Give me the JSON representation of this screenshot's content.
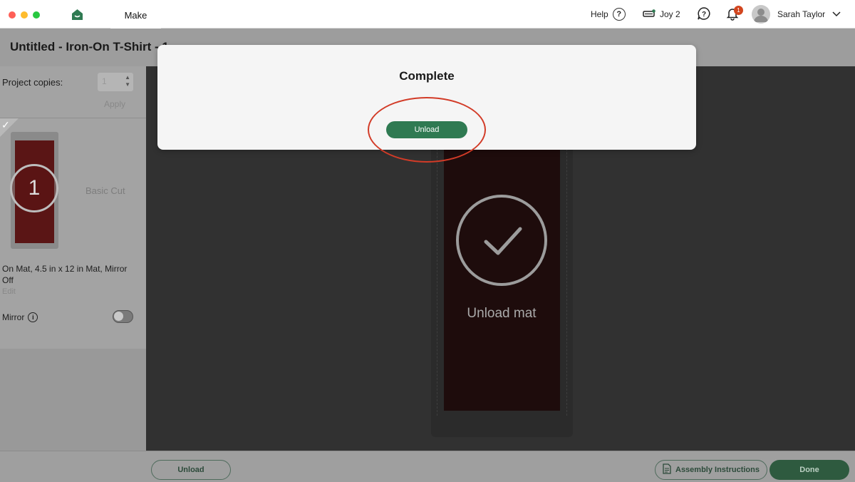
{
  "topbar": {
    "tab_make": "Make",
    "help_label": "Help",
    "machine_label": "Joy 2",
    "notification_count": "1",
    "user_name": "Sarah Taylor"
  },
  "title": {
    "project_name": "Untitled - Iron-On T-Shirt - 1"
  },
  "left_panel": {
    "copies_label": "Project copies:",
    "copies_value": "1",
    "apply_label": "Apply",
    "mat_number": "1",
    "cut_type": "Basic Cut",
    "mat_info": "On Mat, 4.5 in x 12 in Mat, Mirror Off",
    "edit_label": "Edit",
    "mirror_label": "Mirror",
    "mirror_on": false
  },
  "canvas": {
    "unload_mat_label": "Unload mat"
  },
  "bottombar": {
    "unload_label": "Unload",
    "assembly_label": "Assembly Instructions",
    "done_label": "Done"
  },
  "modal": {
    "title": "Complete",
    "button_label": "Unload"
  },
  "colors": {
    "brand_green": "#2f7a52",
    "annotation_red": "#d23b27",
    "badge_orange": "#d2451e"
  }
}
